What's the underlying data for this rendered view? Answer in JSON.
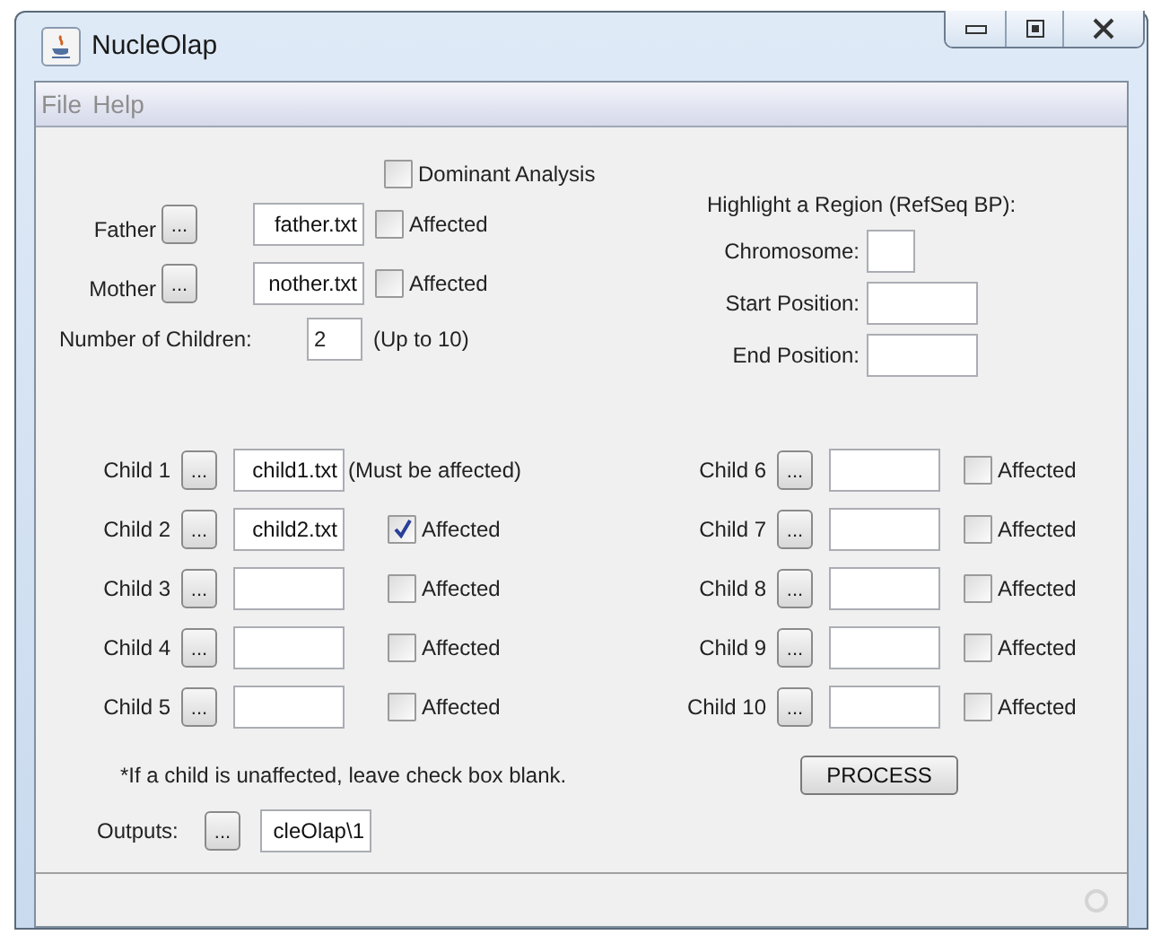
{
  "window": {
    "title": "NucleOlap"
  },
  "menu": [
    {
      "label": "File",
      "disabled": true
    },
    {
      "label": "Help",
      "disabled": true
    }
  ],
  "dominant_analysis": {
    "label": "Dominant Analysis",
    "checked": false
  },
  "parents": [
    {
      "label": "Father",
      "button": "...",
      "value": "father.txt",
      "affected_label": "Affected",
      "checked": false
    },
    {
      "label": "Mother",
      "button": "...",
      "value": "nother.txt",
      "affected_label": "Affected",
      "checked": false
    }
  ],
  "children_count": {
    "label": "Number of Children:",
    "value": "2",
    "hint": "(Up to 10)"
  },
  "region": {
    "title": "Highlight a Region (RefSeq BP):",
    "fields": [
      {
        "label": "Chromosome:"
      },
      {
        "label": "Start Position:"
      },
      {
        "label": "End Position:"
      }
    ]
  },
  "children": [
    {
      "kind": "note",
      "label": "Child 1",
      "button": "...",
      "value": "child1.txt",
      "note": "(Must be affected)"
    },
    {
      "kind": "checkbox",
      "label": "Child 2",
      "button": "...",
      "value": "child2.txt",
      "affected_label": "Affected",
      "checked": true
    },
    {
      "kind": "checkbox",
      "label": "Child 3",
      "button": "...",
      "affected_label": "Affected",
      "checked": false
    },
    {
      "kind": "checkbox",
      "label": "Child 4",
      "button": "...",
      "affected_label": "Affected",
      "checked": false
    },
    {
      "kind": "checkbox",
      "label": "Child 5",
      "button": "...",
      "affected_label": "Affected",
      "checked": false
    },
    {
      "kind": "checkbox",
      "label": "Child 6",
      "button": "...",
      "affected_label": "Affected",
      "checked": false
    },
    {
      "kind": "checkbox",
      "label": "Child 7",
      "button": "...",
      "affected_label": "Affected",
      "checked": false
    },
    {
      "kind": "checkbox",
      "label": "Child 8",
      "button": "...",
      "affected_label": "Affected",
      "checked": false
    },
    {
      "kind": "checkbox",
      "label": "Child 9",
      "button": "...",
      "affected_label": "Affected",
      "checked": false
    },
    {
      "kind": "checkbox",
      "label": "Child 10",
      "button": "...",
      "affected_label": "Affected",
      "checked": false
    }
  ],
  "footnote": "*If a child is unaffected, leave check box blank.",
  "process_button": "PROCESS",
  "outputs": {
    "label": "Outputs:",
    "button": "...",
    "value": "cleOlap\\1"
  }
}
